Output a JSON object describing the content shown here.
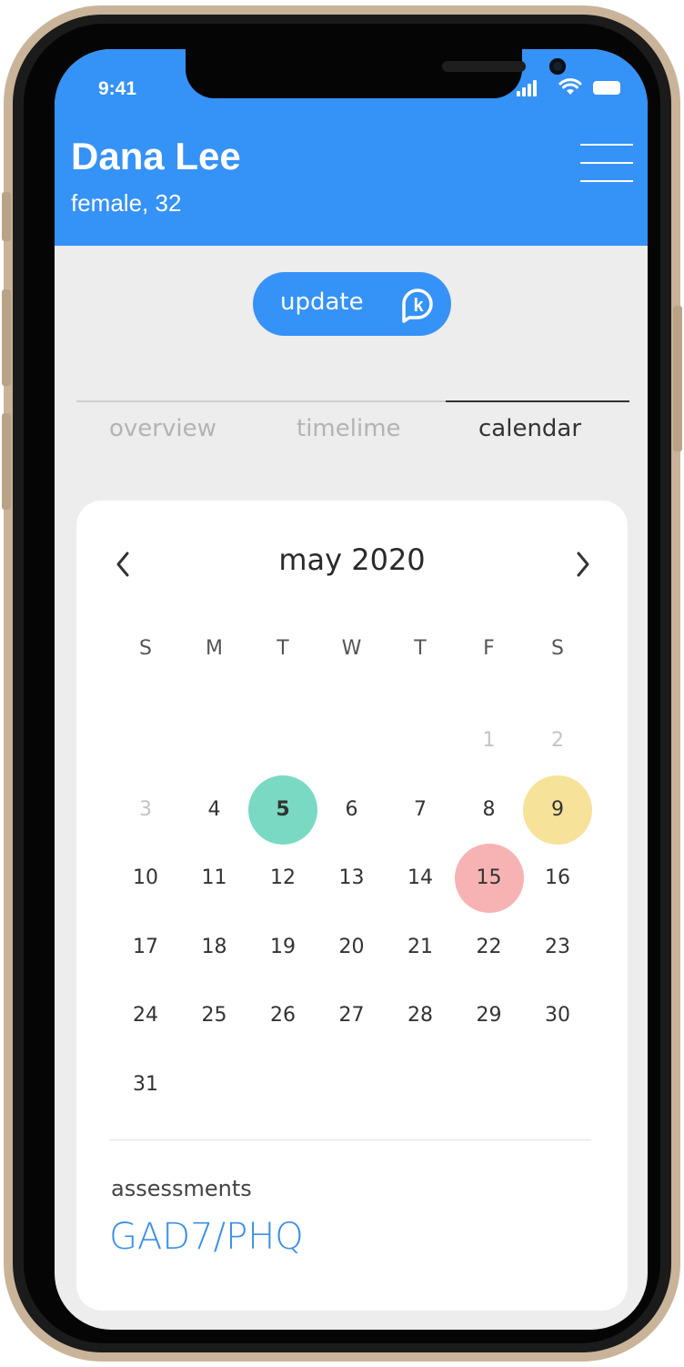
{
  "status_bar": {
    "time": "9:41"
  },
  "header": {
    "name": "Dana Lee",
    "subtitle": "female, 32",
    "menu_icon": "hamburger-menu-icon"
  },
  "update_button": {
    "label": "update",
    "icon": "k-logo-icon"
  },
  "tabs": [
    {
      "label": "overview",
      "active": false
    },
    {
      "label": "timelime",
      "active": false
    },
    {
      "label": "calendar",
      "active": true
    }
  ],
  "calendar": {
    "month_label": "may 2020",
    "prev_icon": "chevron-left-icon",
    "next_icon": "chevron-right-icon",
    "weekdays": [
      "S",
      "M",
      "T",
      "W",
      "T",
      "F",
      "S"
    ],
    "weeks": [
      [
        null,
        null,
        null,
        null,
        null,
        {
          "day": "1",
          "muted": true
        },
        {
          "day": "2",
          "muted": true
        }
      ],
      [
        {
          "day": "3",
          "muted": true
        },
        {
          "day": "4"
        },
        {
          "day": "5",
          "highlight": "#7ad9c2",
          "bold": true
        },
        {
          "day": "6"
        },
        {
          "day": "7"
        },
        {
          "day": "8"
        },
        {
          "day": "9",
          "highlight": "#f7e29a"
        }
      ],
      [
        {
          "day": "10"
        },
        {
          "day": "11"
        },
        {
          "day": "12"
        },
        {
          "day": "13"
        },
        {
          "day": "14"
        },
        {
          "day": "15",
          "highlight": "#f7b3b3"
        },
        {
          "day": "16"
        }
      ],
      [
        {
          "day": "17"
        },
        {
          "day": "18"
        },
        {
          "day": "19"
        },
        {
          "day": "20"
        },
        {
          "day": "21"
        },
        {
          "day": "22"
        },
        {
          "day": "23"
        }
      ],
      [
        {
          "day": "24"
        },
        {
          "day": "25"
        },
        {
          "day": "26"
        },
        {
          "day": "27"
        },
        {
          "day": "28"
        },
        {
          "day": "29"
        },
        {
          "day": "30"
        }
      ],
      [
        {
          "day": "31"
        },
        null,
        null,
        null,
        null,
        null,
        null
      ]
    ]
  },
  "assessments": {
    "label": "assessments",
    "value": "GAD7/PHQ"
  },
  "colors": {
    "accent": "#3592f6",
    "background": "#ededed",
    "link": "#3a8fe6"
  }
}
